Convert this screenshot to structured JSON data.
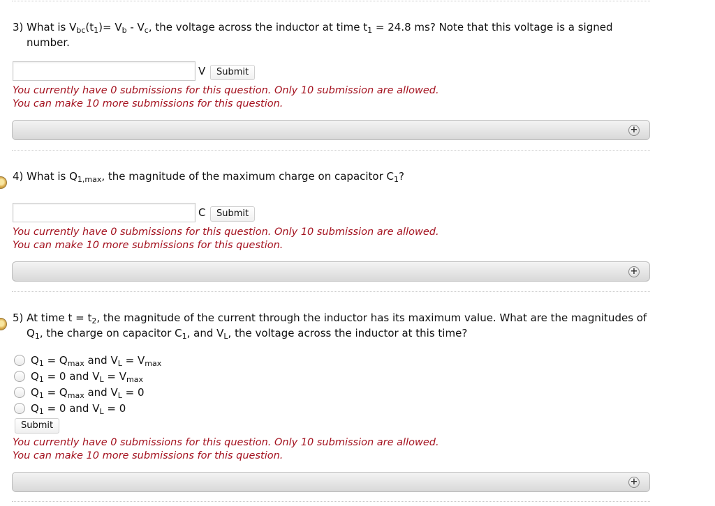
{
  "q3": {
    "prefix": "3) What is V",
    "sub_bc": "bc",
    "t_open": "(t",
    "sub_1a": "1",
    "mid1": ")= V",
    "sub_b": "b",
    "mid2": " - V",
    "sub_c": "c",
    "mid3": ", the voltage across the inductor at time t",
    "sub_1b": "1",
    "tail": " = 24.8 ms? Note that this voltage is a signed",
    "line2": "number.",
    "unit": "V",
    "submit": "Submit",
    "info1": "You currently have 0 submissions for this question. Only 10 submission are allowed.",
    "info2": "You can make 10 more submissions for this question."
  },
  "q4": {
    "prefix": "4) What is Q",
    "sub_1max": "1,max",
    "mid": ", the magnitude of the maximum charge on capacitor C",
    "sub_1": "1",
    "tail": "?",
    "unit": "C",
    "submit": "Submit",
    "info1": "You currently have 0 submissions for this question. Only 10 submission are allowed.",
    "info2": "You can make 10 more submissions for this question."
  },
  "q5": {
    "prefix": "5) At time t = t",
    "sub_2": "2",
    "tail1": ", the magnitude of the current through the inductor has its maximum value. What are the magnitudes of",
    "l2a": "Q",
    "l2_sub1": "1",
    "l2b": ", the charge on capacitor C",
    "l2_sub2": "1",
    "l2c": ", and V",
    "l2_subL": "L",
    "l2d": ", the voltage across the inductor at this time?",
    "options": [
      {
        "a": "Q",
        "s1": "1",
        "b": " = Q",
        "s2": "max",
        "c": " and V",
        "s3": "L",
        "d": " = V",
        "s4": "max",
        "e": ""
      },
      {
        "a": "Q",
        "s1": "1",
        "b": " = 0 and V",
        "s2": "L",
        "c": " = V",
        "s3": "max",
        "d": "",
        "s4": "",
        "e": ""
      },
      {
        "a": "Q",
        "s1": "1",
        "b": " = Q",
        "s2": "max",
        "c": " and V",
        "s3": "L",
        "d": " = 0",
        "s4": "",
        "e": ""
      },
      {
        "a": "Q",
        "s1": "1",
        "b": " = 0 and V",
        "s2": "L",
        "c": " = 0",
        "s3": "",
        "d": "",
        "s4": "",
        "e": ""
      }
    ],
    "submit": "Submit",
    "info1": "You currently have 0 submissions for this question. Only 10 submission are allowed.",
    "info2": "You can make 10 more submissions for this question."
  },
  "expand_symbol": "+"
}
